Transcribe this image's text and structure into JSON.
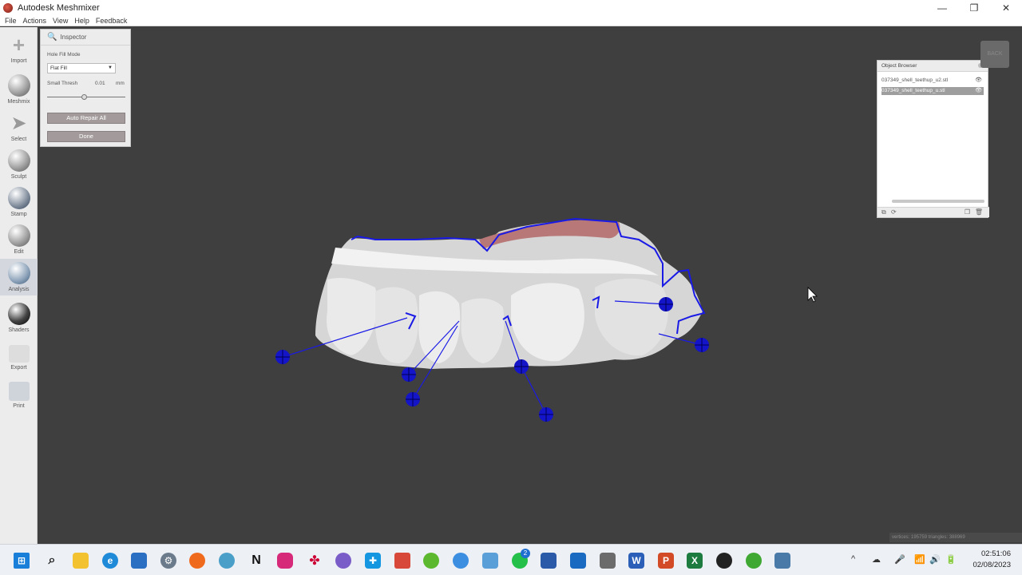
{
  "window": {
    "title": "Autodesk Meshmixer",
    "minimize": "—",
    "restore": "❐",
    "close": "✕"
  },
  "menu": [
    "File",
    "Actions",
    "View",
    "Help",
    "Feedback"
  ],
  "tools": [
    {
      "label": "Import",
      "icon": "plus-icon"
    },
    {
      "label": "Meshmix",
      "icon": "meshmix-icon"
    },
    {
      "label": "Select",
      "icon": "select-arrow-icon"
    },
    {
      "label": "Sculpt",
      "icon": "sculpt-brush-icon"
    },
    {
      "label": "Stamp",
      "icon": "stamp-icon"
    },
    {
      "label": "Edit",
      "icon": "edit-icon"
    },
    {
      "label": "Analysis",
      "icon": "analysis-icon",
      "active": true
    },
    {
      "label": "Shaders",
      "icon": "shaders-icon"
    },
    {
      "label": "Export",
      "icon": "export-icon"
    },
    {
      "label": "Print",
      "icon": "print-icon"
    }
  ],
  "inspector": {
    "title": "Inspector",
    "hole_fill_label": "Hole Fill Mode",
    "hole_fill_value": "Flat Fill",
    "small_thresh_label": "Small Thresh",
    "small_thresh_value": "0.01",
    "small_thresh_unit": "mm",
    "small_thresh_slider": 0.48,
    "auto_repair_label": "Auto Repair All",
    "done_label": "Done"
  },
  "object_browser": {
    "title": "Object Browser",
    "items": [
      {
        "name": "037349_shell_teethup_u2.stl",
        "selected": false
      },
      {
        "name": "037349_shell_teethup_u.stl",
        "selected": true
      }
    ]
  },
  "back_label": "BACK",
  "status_text": "vertices: 195759 triangles: 388969",
  "clock": {
    "time": "02:51:06",
    "date": "02/08/2023"
  },
  "taskbar_badge": "2",
  "colors": {
    "boundary": "#1a1ae6",
    "marker": "#1414c8",
    "mesh": "#d9d9d9",
    "gum": "#b97878"
  }
}
